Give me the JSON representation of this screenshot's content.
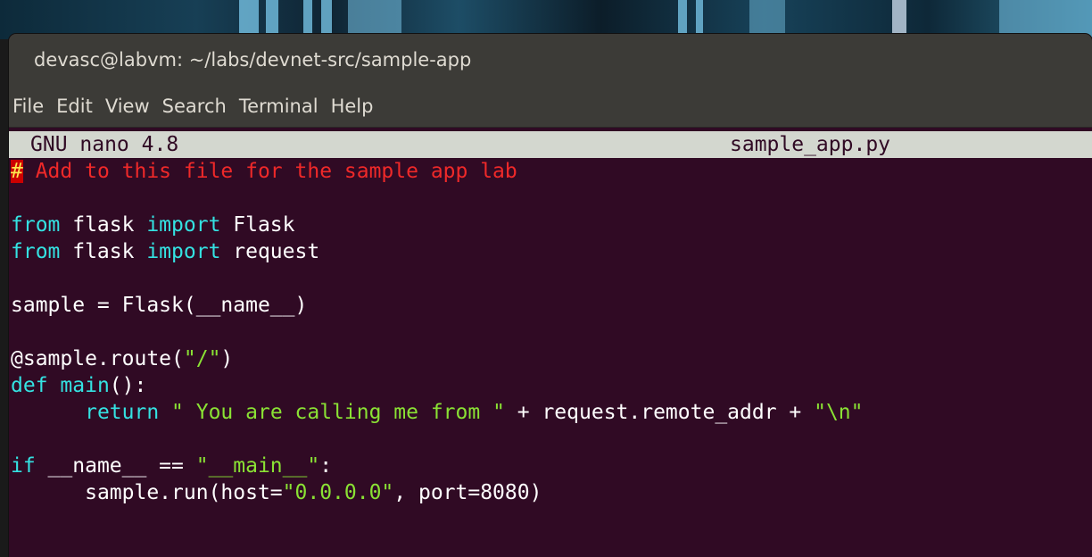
{
  "window": {
    "title": "devasc@labvm: ~/labs/devnet-src/sample-app"
  },
  "menu": {
    "items": [
      "File",
      "Edit",
      "View",
      "Search",
      "Terminal",
      "Help"
    ]
  },
  "nano": {
    "version": "GNU nano 4.8",
    "filename": "sample_app.py"
  },
  "code": {
    "line1_hash": "#",
    "line1_comment": " Add to this file for the sample app lab",
    "line3_from": "from",
    "line3_mod": " flask ",
    "line3_import": "import",
    "line3_name": " Flask",
    "line4_from": "from",
    "line4_mod": " flask ",
    "line4_import": "import",
    "line4_name": " request",
    "line6": "sample = Flask(__name__)",
    "line8_deco": "@sample.route(",
    "line8_str": "\"/\"",
    "line8_end": ")",
    "line9_def": "def",
    "line9_sp": " ",
    "line9_fn": "main",
    "line9_end": "():",
    "line10_indent": "      ",
    "line10_return": "return",
    "line10_sp": " ",
    "line10_str1": "\" You are calling me from \"",
    "line10_mid": " + request.remote_addr + ",
    "line10_str2": "\"\\n\"",
    "line12_if": "if",
    "line12_mid": " __name__ == ",
    "line12_str": "\"__main__\"",
    "line12_end": ":",
    "line13_indent": "      ",
    "line13_a": "sample.run(host=",
    "line13_str": "\"0.0.0.0\"",
    "line13_b": ", port=8080)"
  },
  "colors": {
    "terminal_bg": "#300a24",
    "comment": "#ef2929",
    "keyword": "#34e2e2",
    "string": "#8ae234",
    "nano_header_bg": "#d3d7cf"
  }
}
